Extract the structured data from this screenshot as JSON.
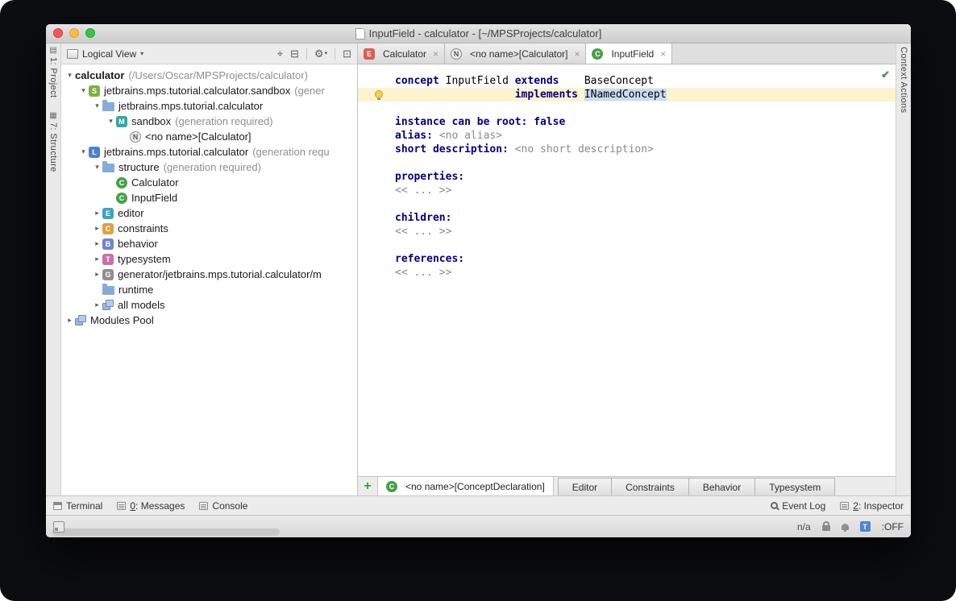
{
  "colors": {
    "kw-navy": "#000080",
    "hl-yellow": "#fcf3cf",
    "sel-blue": "#c8ddf4",
    "check-green": "#3f9e3c",
    "badge-blue": "#4f86d2",
    "traffic-red": "#fc5753",
    "traffic-yellow": "#fdbc40",
    "traffic-green": "#33c748"
  },
  "window": {
    "title": "InputField - calculator - [~/MPSProjects/calculator]"
  },
  "left_stripe": {
    "items": [
      {
        "label": "1: Project",
        "icon_glyph": "▤",
        "name": "toolwindow-project"
      },
      {
        "label": "7: Structure",
        "icon_glyph": "▦",
        "name": "toolwindow-structure"
      }
    ]
  },
  "right_stripe": {
    "items": [
      {
        "label": "Context Actions",
        "name": "toolwindow-context-actions"
      }
    ]
  },
  "icons": {
    "solution": {
      "shape": "square",
      "letter": "S",
      "color": "#7fb043",
      "name": "solution-module-icon"
    },
    "model": {
      "shape": "square",
      "letter": "M",
      "color": "#2fa8a0",
      "name": "model-icon"
    },
    "node": {
      "shape": "circle",
      "letter": "N",
      "color": "#ededed",
      "text_color": "#555555",
      "border": "#8a8a8a",
      "name": "node-icon"
    },
    "language": {
      "shape": "square",
      "letter": "L",
      "color": "#4b80d2",
      "name": "language-module-icon"
    },
    "folder": {
      "shape": "folder",
      "name": "folder-icon"
    },
    "concept": {
      "shape": "circle",
      "letter": "C",
      "color": "#46a149",
      "name": "concept-icon"
    },
    "editor-aspect": {
      "shape": "square",
      "letter": "E",
      "color": "#d85f52",
      "name": "editor-aspect-icon"
    },
    "editor-model": {
      "shape": "square",
      "letter": "E",
      "color": "#3da4c4",
      "name": "editor-model-icon"
    },
    "constraints-model": {
      "shape": "square",
      "letter": "C",
      "color": "#dca345",
      "name": "constraints-model-icon"
    },
    "behavior-model": {
      "shape": "square",
      "letter": "B",
      "color": "#6f86c9",
      "name": "behavior-model-icon"
    },
    "typesystem-model": {
      "shape": "square",
      "letter": "T",
      "color": "#c96fae",
      "name": "typesystem-model-icon"
    },
    "generator": {
      "shape": "square",
      "letter": "G",
      "color": "#8f8f8f",
      "name": "generator-icon"
    },
    "stack": {
      "shape": "stack",
      "name": "models-stack-icon"
    },
    "modules-pool": {
      "shape": "stack",
      "name": "modules-pool-icon"
    }
  },
  "project_panel": {
    "view_selector": "Logical View",
    "toolbar_icons": [
      {
        "name": "locate-icon",
        "glyph": "⌖"
      },
      {
        "name": "collapse-all-icon",
        "glyph": "⊟"
      },
      {
        "name": "divider"
      },
      {
        "name": "settings-icon",
        "glyph": "⚙",
        "dropdown": true
      },
      {
        "name": "divider"
      },
      {
        "name": "hide-panel-icon",
        "glyph": "⊡"
      }
    ],
    "tree": [
      {
        "indent": 0,
        "arrow": "down",
        "icon": null,
        "label": "calculator",
        "suffix": "(/Users/Oscar/MPSProjects/calculator)",
        "bold": true
      },
      {
        "indent": 1,
        "arrow": "down",
        "icon": "solution",
        "label": "jetbrains.mps.tutorial.calculator.sandbox",
        "suffix": "(gener"
      },
      {
        "indent": 2,
        "arrow": "down",
        "icon": "folder",
        "label": "jetbrains.mps.tutorial.calculator"
      },
      {
        "indent": 3,
        "arrow": "down",
        "icon": "model",
        "label": "sandbox",
        "suffix": "(generation required)"
      },
      {
        "indent": 4,
        "arrow": "none",
        "icon": "node",
        "label": "<no name>[Calculator]"
      },
      {
        "indent": 1,
        "arrow": "down",
        "icon": "language",
        "label": "jetbrains.mps.tutorial.calculator",
        "suffix": "(generation requ"
      },
      {
        "indent": 2,
        "arrow": "down",
        "icon": "folder",
        "label": "structure",
        "suffix": "(generation required)"
      },
      {
        "indent": 3,
        "arrow": "none",
        "icon": "concept",
        "label": "Calculator"
      },
      {
        "indent": 3,
        "arrow": "none",
        "icon": "concept",
        "label": "InputField"
      },
      {
        "indent": 2,
        "arrow": "right",
        "icon": "editor-model",
        "label": "editor"
      },
      {
        "indent": 2,
        "arrow": "right",
        "icon": "constraints-model",
        "label": "constraints"
      },
      {
        "indent": 2,
        "arrow": "right",
        "icon": "behavior-model",
        "label": "behavior"
      },
      {
        "indent": 2,
        "arrow": "right",
        "icon": "typesystem-model",
        "label": "typesystem"
      },
      {
        "indent": 2,
        "arrow": "right",
        "icon": "generator",
        "label": "generator/jetbrains.mps.tutorial.calculator/m"
      },
      {
        "indent": 2,
        "arrow": "none",
        "icon": "folder",
        "label": "runtime"
      },
      {
        "indent": 2,
        "arrow": "right",
        "icon": "stack",
        "label": "all models"
      },
      {
        "indent": 0,
        "arrow": "right",
        "icon": "modules-pool",
        "label": "Modules Pool"
      }
    ]
  },
  "editor": {
    "tabs": [
      {
        "label": "Calculator",
        "icon": "editor-aspect",
        "active": false
      },
      {
        "label": "<no name>[Calculator]",
        "icon": "node",
        "active": false
      },
      {
        "label": "InputField",
        "icon": "concept",
        "active": true
      }
    ],
    "check_glyph": "✔",
    "code_lines": [
      {
        "segments": [
          {
            "t": "concept ",
            "s": "kw"
          },
          {
            "t": "InputField ",
            "s": "pl"
          },
          {
            "t": "extends",
            "s": "kw"
          },
          {
            "t": "    ",
            "s": "pl"
          },
          {
            "t": "BaseConcept",
            "s": "pl"
          }
        ]
      },
      {
        "hl": true,
        "segments": [
          {
            "t": "                   ",
            "s": "pl"
          },
          {
            "t": "implements ",
            "s": "kw"
          },
          {
            "t": "INamedConcept",
            "s": "pl sel"
          }
        ]
      },
      {
        "segments": []
      },
      {
        "segments": [
          {
            "t": "instance can be root: ",
            "s": "kw"
          },
          {
            "t": "false",
            "s": "kw"
          }
        ]
      },
      {
        "segments": [
          {
            "t": "alias: ",
            "s": "kw"
          },
          {
            "t": "<no alias>",
            "s": "gray"
          }
        ]
      },
      {
        "segments": [
          {
            "t": "short description: ",
            "s": "kw"
          },
          {
            "t": "<no short description>",
            "s": "gray"
          }
        ]
      },
      {
        "segments": []
      },
      {
        "segments": [
          {
            "t": "properties:",
            "s": "kw"
          }
        ]
      },
      {
        "segments": [
          {
            "t": "<< ... >>",
            "s": "gray"
          }
        ]
      },
      {
        "segments": []
      },
      {
        "segments": [
          {
            "t": "children:",
            "s": "kw"
          }
        ]
      },
      {
        "segments": [
          {
            "t": "<< ... >>",
            "s": "gray"
          }
        ]
      },
      {
        "segments": []
      },
      {
        "segments": [
          {
            "t": "references:",
            "s": "kw"
          }
        ]
      },
      {
        "segments": [
          {
            "t": "<< ... >>",
            "s": "gray"
          }
        ]
      }
    ],
    "bottom": {
      "add_label": "+",
      "node_tab": {
        "label": "<no name>[ConceptDeclaration]",
        "icon": "concept"
      },
      "aspect_tabs": [
        "Editor",
        "Constraints",
        "Behavior",
        "Typesystem"
      ]
    }
  },
  "bottom_bar": {
    "left": [
      {
        "label": "Terminal",
        "icon": "terminal-icon"
      },
      {
        "label": "0: Messages",
        "icon": "messages-icon",
        "mnemonic": true
      },
      {
        "label": "Console",
        "icon": "console-icon"
      }
    ],
    "right": [
      {
        "label": "Event Log",
        "icon": "magnifier-icon"
      },
      {
        "label": "2: Inspector",
        "icon": "inspector-icon",
        "mnemonic": true
      }
    ]
  },
  "status_bar": {
    "position_text": "n/a",
    "badge_letter": "T",
    "toggle_text": ":OFF"
  }
}
